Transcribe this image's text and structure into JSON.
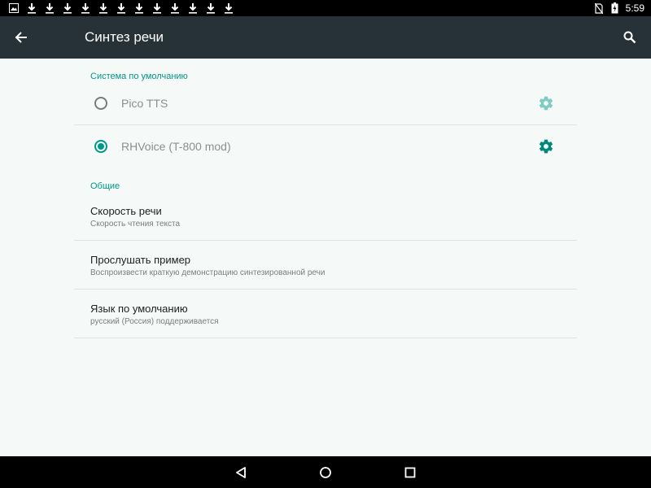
{
  "status_bar": {
    "time": "5:59",
    "left_icons": [
      "image-notification-icon",
      "download-icon",
      "download-icon",
      "download-icon",
      "download-icon",
      "download-icon",
      "download-icon",
      "download-icon",
      "download-icon",
      "download-icon",
      "download-icon",
      "download-icon",
      "download-icon"
    ],
    "right_icons": [
      "no-sim-icon",
      "battery-charging-icon"
    ]
  },
  "app_bar": {
    "title": "Синтез речи",
    "background": "#263238"
  },
  "default_engine_section": {
    "header": "Система по умолчанию",
    "engines": [
      {
        "label": "Pico TTS",
        "selected": false,
        "settings_icon": "gear-icon"
      },
      {
        "label": "RHVoice (T-800 mod)",
        "selected": true,
        "settings_icon": "gear-icon"
      }
    ]
  },
  "general_section": {
    "header": "Общие",
    "items": [
      {
        "title": "Скорость речи",
        "summary": "Скорость чтения текста"
      },
      {
        "title": "Прослушать пример",
        "summary": "Воспроизвести краткую демонстрацию синтезированной речи"
      },
      {
        "title": "Язык по умолчанию",
        "summary": "русский (Россия) поддерживается"
      }
    ]
  },
  "nav_bar": {
    "buttons": [
      "back-icon",
      "home-icon",
      "recents-icon"
    ]
  },
  "colors": {
    "accent": "#009688",
    "background": "#f5faf8",
    "gear_disabled": "#80cbc4"
  }
}
